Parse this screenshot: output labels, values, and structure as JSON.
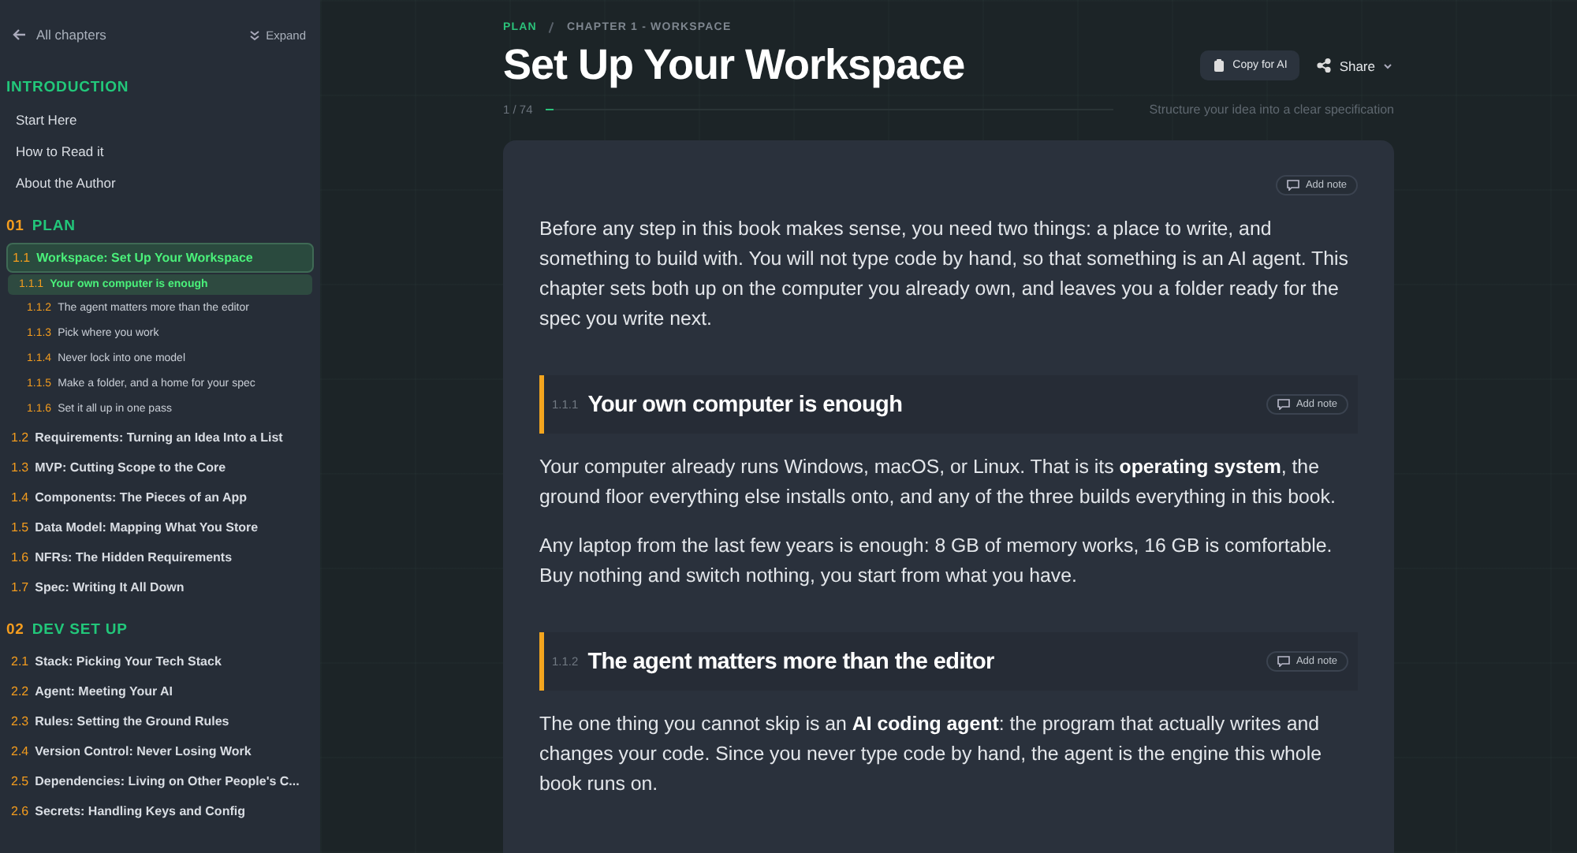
{
  "sidebar": {
    "back": "All chapters",
    "expand": "Expand",
    "sections": [
      {
        "title": "INTRODUCTION",
        "items": [
          {
            "label": "Start Here",
            "selected": false
          },
          {
            "label": "How to Read it",
            "selected": false
          },
          {
            "label": "About the Author",
            "selected": false
          }
        ]
      },
      {
        "number": "01",
        "title": "PLAN",
        "items": [
          {
            "number": "1.1",
            "label": "Workspace: Set Up Your Workspace",
            "selected": true,
            "children": [
              {
                "number": "1.1.1",
                "label": "Your own computer is enough",
                "selected": true
              },
              {
                "number": "1.1.2",
                "label": "The agent matters more than the editor",
                "selected": false
              },
              {
                "number": "1.1.3",
                "label": "Pick where you work",
                "selected": false
              },
              {
                "number": "1.1.4",
                "label": "Never lock into one model",
                "selected": false
              },
              {
                "number": "1.1.5",
                "label": "Make a folder, and a home for your spec",
                "selected": false
              },
              {
                "number": "1.1.6",
                "label": "Set it all up in one pass",
                "selected": false
              }
            ]
          },
          {
            "number": "1.2",
            "label": "Requirements: Turning an Idea Into a List",
            "selected": false
          },
          {
            "number": "1.3",
            "label": "MVP: Cutting Scope to the Core",
            "selected": false
          },
          {
            "number": "1.4",
            "label": "Components: The Pieces of an App",
            "selected": false
          },
          {
            "number": "1.5",
            "label": "Data Model: Mapping What You Store",
            "selected": false
          },
          {
            "number": "1.6",
            "label": "NFRs: The Hidden Requirements",
            "selected": false
          },
          {
            "number": "1.7",
            "label": "Spec: Writing It All Down",
            "selected": false
          }
        ]
      },
      {
        "number": "02",
        "title": "DEV SET UP",
        "items": [
          {
            "number": "2.1",
            "label": "Stack: Picking Your Tech Stack",
            "selected": false
          },
          {
            "number": "2.2",
            "label": "Agent: Meeting Your AI",
            "selected": false
          },
          {
            "number": "2.3",
            "label": "Rules: Setting the Ground Rules",
            "selected": false
          },
          {
            "number": "2.4",
            "label": "Version Control: Never Losing Work",
            "selected": false
          },
          {
            "number": "2.5",
            "label": "Dependencies: Living on Other People's C...",
            "selected": false
          },
          {
            "number": "2.6",
            "label": "Secrets: Handling Keys and Config",
            "selected": false
          }
        ]
      }
    ]
  },
  "breadcrumb": [
    "PLAN",
    "CHAPTER 1 - WORKSPACE"
  ],
  "title": "Set Up Your Workspace",
  "actions": {
    "copy": "Copy for AI",
    "share": "Share"
  },
  "progress": {
    "counter": "1 / 74",
    "level": 0.014,
    "subtitle": "Structure your idea into a clear specification"
  },
  "article": {
    "note": "Add note",
    "blocks": [
      {
        "kind": "paragraph",
        "text": "Before any step in this book makes sense, you need two things: a place to write, and something to build with. You will not type code by hand, so that something is an AI agent. This chapter sets both up on the computer you already own, and leaves you a folder ready for the spec you write next."
      },
      {
        "kind": "heading",
        "number": "1.1.1",
        "text": "Your own computer is enough",
        "note": "Add note"
      },
      {
        "kind": "paragraph",
        "text": "Your computer already runs Windows, macOS, or Linux. That is its **operating system**, the ground floor everything else installs onto, and any of the three builds everything in this book."
      },
      {
        "kind": "paragraph",
        "text": "Any laptop from the last few years is enough: 8 GB of memory works, 16 GB is comfortable. Buy nothing and switch nothing, you start from what you have."
      },
      {
        "kind": "heading",
        "number": "1.1.2",
        "text": "The agent matters more than the editor",
        "note": "Add note"
      },
      {
        "kind": "paragraph",
        "text": "The one thing you cannot skip is an **AI coding agent**: the program that actually writes and changes your code. Since you never type code by hand, the agent is the engine this whole book runs on."
      }
    ]
  }
}
